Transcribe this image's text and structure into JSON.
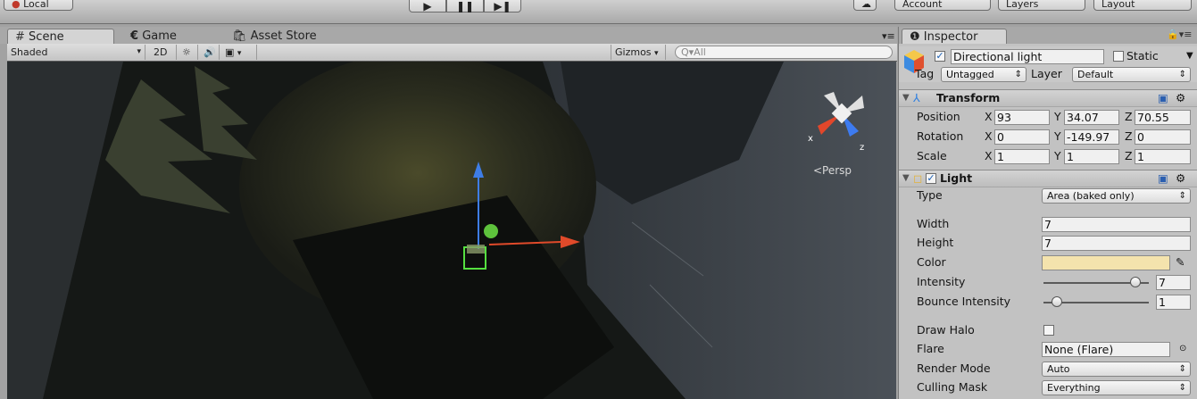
{
  "toolbar": {
    "local_label": "Local",
    "play": "▶",
    "pause": "❚❚",
    "step": "▶❚",
    "account_label": "Account",
    "layers_label": "Layers",
    "layout_label": "Layout"
  },
  "scene_tabs": {
    "scene": "Scene",
    "game": "Game",
    "asset_store": "Asset Store",
    "menu_glyph": "▾≡"
  },
  "scene_bar": {
    "draw_mode": "Shaded",
    "twod": "2D",
    "gizmos": "Gizmos",
    "search_placeholder": "Q▾All"
  },
  "scene_view": {
    "persp_label": "<Persp",
    "axis_x": "x",
    "axis_z": "z"
  },
  "inspector": {
    "tab_label": "Inspector",
    "object_name": "Directional light",
    "static_label": "Static",
    "tag_label": "Tag",
    "tag_value": "Untagged",
    "layer_label": "Layer",
    "layer_value": "Default",
    "transform": {
      "title": "Transform",
      "position_label": "Position",
      "rotation_label": "Rotation",
      "scale_label": "Scale",
      "x": "X",
      "y": "Y",
      "z": "Z",
      "position": [
        "93",
        "34.07",
        "70.55"
      ],
      "rotation": [
        "0",
        "-149.97",
        "0"
      ],
      "scale": [
        "1",
        "1",
        "1"
      ]
    },
    "light": {
      "title": "Light",
      "type_label": "Type",
      "type_value": "Area (baked only)",
      "width_label": "Width",
      "width_value": "7",
      "height_label": "Height",
      "height_value": "7",
      "color_label": "Color",
      "color_value": "#f4e3ad",
      "intensity_label": "Intensity",
      "intensity_value": "7",
      "intensity_fraction": 0.875,
      "bounce_label": "Bounce Intensity",
      "bounce_value": "1",
      "bounce_fraction": 0.125,
      "draw_halo_label": "Draw Halo",
      "flare_label": "Flare",
      "flare_value": "None (Flare)",
      "render_mode_label": "Render Mode",
      "render_mode_value": "Auto",
      "culling_mask_label": "Culling Mask",
      "culling_mask_value": "Everything"
    }
  }
}
